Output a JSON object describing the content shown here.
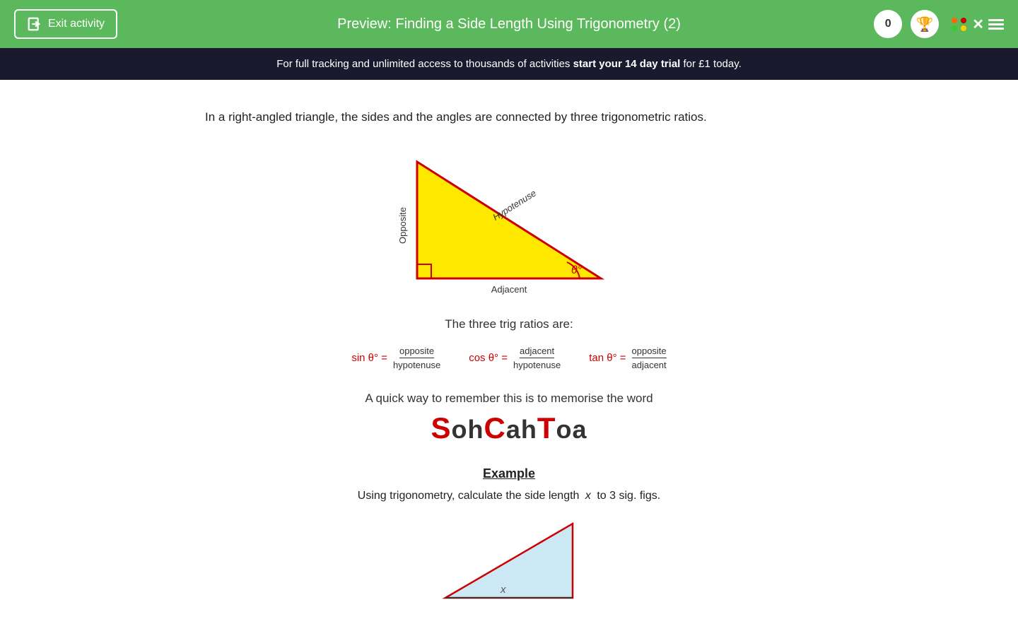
{
  "header": {
    "exit_label": "Exit activity",
    "title": "Preview: Finding a Side Length Using Trigonometry (2)",
    "score": "0"
  },
  "banner": {
    "text_before": "For full tracking and unlimited access to thousands of activities ",
    "cta": "start your 14 day trial",
    "text_after": " for £1 today."
  },
  "content": {
    "intro": "In a right-angled triangle, the sides and the angles are connected by three trigonometric ratios.",
    "triangle_labels": {
      "opposite": "Opposite",
      "hypotenuse": "Hypotenuse",
      "adjacent": "Adjacent",
      "theta": "θ°"
    },
    "three_trig_title": "The three trig ratios are:",
    "ratios": [
      {
        "label": "sin θ° =",
        "numerator": "opposite",
        "denominator": "hypotenuse"
      },
      {
        "label": "cos θ° =",
        "numerator": "adjacent",
        "denominator": "hypotenuse"
      },
      {
        "label": "tan θ° =",
        "numerator": "opposite",
        "denominator": "adjacent"
      }
    ],
    "remember_text": "A quick way to remember this is to memorise the word",
    "sohcahtoa": {
      "S": "S",
      "oh": "oh",
      "C": "C",
      "ah": "ah",
      "T": "T",
      "oa": "oa"
    },
    "example_title": "Example",
    "example_text": "Using trigonometry, calculate the side length",
    "example_variable": "x",
    "example_text2": "to 3 sig. figs."
  }
}
